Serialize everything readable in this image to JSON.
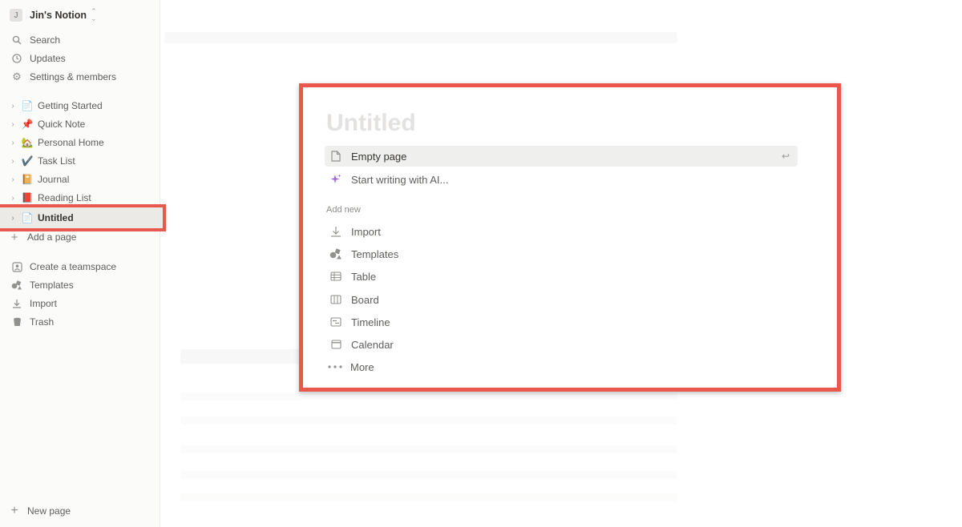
{
  "workspace": {
    "initial": "J",
    "name": "Jin's Notion"
  },
  "sidebar": {
    "top": [
      {
        "label": "Search",
        "icon": "search-icon"
      },
      {
        "label": "Updates",
        "icon": "clock-icon"
      },
      {
        "label": "Settings & members",
        "icon": "gear-icon"
      }
    ],
    "pages": [
      {
        "label": "Getting Started",
        "emoji": "📄"
      },
      {
        "label": "Quick Note",
        "emoji": "📌"
      },
      {
        "label": "Personal Home",
        "emoji": "🏡"
      },
      {
        "label": "Task List",
        "emoji": "✔️"
      },
      {
        "label": "Journal",
        "emoji": "📔"
      },
      {
        "label": "Reading List",
        "emoji": "📕"
      },
      {
        "label": "Untitled",
        "emoji": "📄"
      }
    ],
    "add_page": "Add a page",
    "bottom": [
      {
        "label": "Create a teamspace"
      },
      {
        "label": "Templates"
      },
      {
        "label": "Import"
      },
      {
        "label": "Trash"
      }
    ],
    "new_page": "New page"
  },
  "popup": {
    "title": "Untitled",
    "empty_page": "Empty page",
    "enter_glyph": "↩",
    "ai": "Start writing with AI...",
    "add_new_label": "Add new",
    "options": [
      "Import",
      "Templates",
      "Table",
      "Board",
      "Timeline",
      "Calendar",
      "More"
    ]
  },
  "colors": {
    "highlight_border": "#e9574d",
    "sidebar_bg": "#fbfbfa"
  }
}
